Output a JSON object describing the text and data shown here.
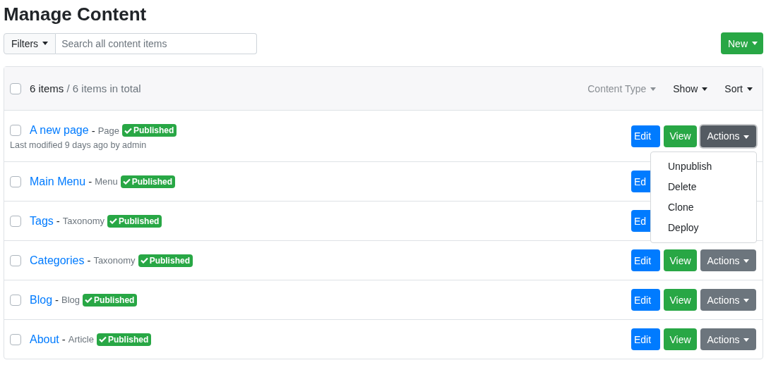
{
  "page_title": "Manage Content",
  "filters": {
    "label": "Filters",
    "search_placeholder": "Search all content items"
  },
  "new_button": {
    "label": "New"
  },
  "list_header": {
    "checked": false,
    "count": "6 items",
    "total": " / 6 items in total",
    "menus": [
      {
        "label": "Content Type",
        "disabled": true
      },
      {
        "label": "Show",
        "disabled": false
      },
      {
        "label": "Sort",
        "disabled": false
      }
    ]
  },
  "rows": [
    {
      "checked": false,
      "title": "A new page",
      "separator": "-",
      "type": "Page",
      "status": "Published",
      "meta": "Last modified 9 days ago by admin",
      "buttons": [
        {
          "kind": "edit",
          "label": "Edit"
        },
        {
          "kind": "view",
          "label": "View"
        },
        {
          "kind": "actions",
          "label": "Actions",
          "expanded": true,
          "menu": [
            "Unpublish",
            "Delete",
            "Clone",
            "Deploy"
          ]
        }
      ]
    },
    {
      "checked": false,
      "title": "Main Menu",
      "separator": "-",
      "type": "Menu",
      "status": "Published",
      "buttons": [
        {
          "kind": "edit",
          "label": "Ed"
        }
      ]
    },
    {
      "checked": false,
      "title": "Tags",
      "separator": "-",
      "type": "Taxonomy",
      "status": "Published",
      "buttons": [
        {
          "kind": "edit",
          "label": "Ed"
        }
      ]
    },
    {
      "checked": false,
      "title": "Categories",
      "separator": "-",
      "type": "Taxonomy",
      "status": "Published",
      "buttons": [
        {
          "kind": "edit",
          "label": "Edit"
        },
        {
          "kind": "view",
          "label": "View"
        },
        {
          "kind": "actions",
          "label": "Actions",
          "expanded": false
        }
      ]
    },
    {
      "checked": false,
      "title": "Blog",
      "separator": "-",
      "type": "Blog",
      "status": "Published",
      "buttons": [
        {
          "kind": "edit",
          "label": "Edit"
        },
        {
          "kind": "view",
          "label": "View"
        },
        {
          "kind": "actions",
          "label": "Actions",
          "expanded": false
        }
      ]
    },
    {
      "checked": false,
      "title": "About",
      "separator": "-",
      "type": "Article",
      "status": "Published",
      "buttons": [
        {
          "kind": "edit",
          "label": "Edit"
        },
        {
          "kind": "view",
          "label": "View"
        },
        {
          "kind": "actions",
          "label": "Actions",
          "expanded": false
        }
      ]
    }
  ]
}
